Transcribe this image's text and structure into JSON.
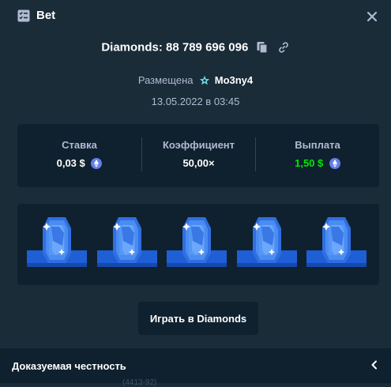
{
  "header": {
    "title": "Bet",
    "icon": "bet-slip-icon",
    "close_icon": "close-icon"
  },
  "bet": {
    "title": "Diamonds: 88 789 696 096",
    "placed_label": "Размещена",
    "username": "Mo3ny4",
    "date": "13.05.2022 в 03:45"
  },
  "stats": {
    "stake_label": "Ставка",
    "stake_value": "0,03 $",
    "multiplier_label": "Коэффициент",
    "multiplier_value": "50,00×",
    "payout_label": "Выплата",
    "payout_value": "1,50 $",
    "coin_icon": "ethereum-coin-icon"
  },
  "gems": {
    "count": 5,
    "icon": "diamond-gem-icon"
  },
  "play_button": "Играть в Diamonds",
  "footer": {
    "label": "Доказуемая честность",
    "chevron_icon": "chevron-left-icon",
    "faint_text": "(4413-92)"
  },
  "colors": {
    "background": "#1a2c38",
    "panel": "#0f212e",
    "muted": "#b1bad3",
    "green": "#00e701",
    "gem": "#3b7de9",
    "platform": "#1f5fd6"
  }
}
